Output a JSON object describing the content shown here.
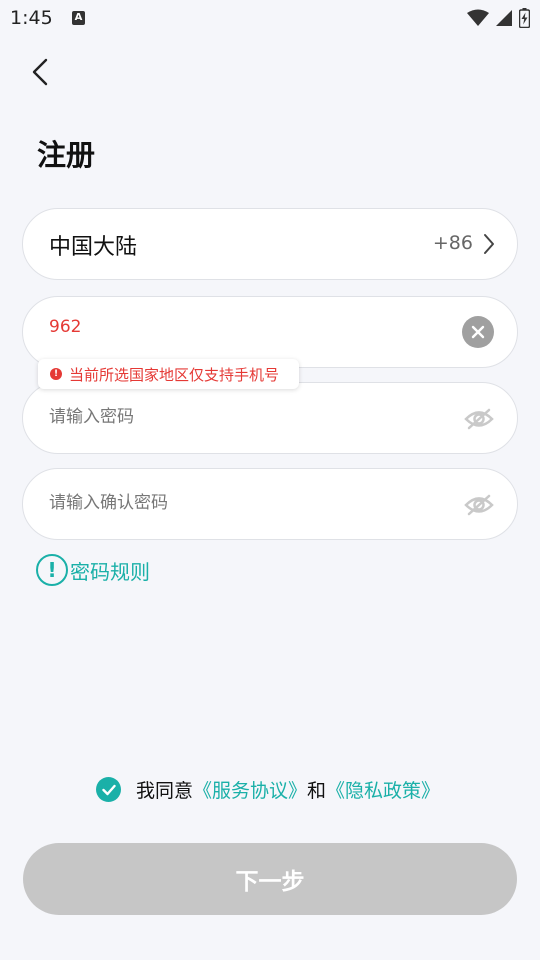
{
  "status_bar": {
    "time": "1:45",
    "notification_icon": "A"
  },
  "header": {
    "title": "注册"
  },
  "region": {
    "name": "中国大陆",
    "code": "+86"
  },
  "phone": {
    "value": "962",
    "error": "当前所选国家地区仅支持手机号"
  },
  "password": {
    "placeholder": "请输入密码"
  },
  "confirm_password": {
    "placeholder": "请输入确认密码"
  },
  "password_rules": {
    "icon_text": "!",
    "label": "密码规则"
  },
  "agreement": {
    "prefix": "我同意",
    "service_link": "《服务协议》",
    "and": "和",
    "privacy_link": "《隐私政策》"
  },
  "next_button": {
    "label": "下一步"
  },
  "colors": {
    "accent": "#1ab0a8",
    "error": "#e53935",
    "disabled_button": "#c6c6c6",
    "background": "#f5f6fa"
  }
}
